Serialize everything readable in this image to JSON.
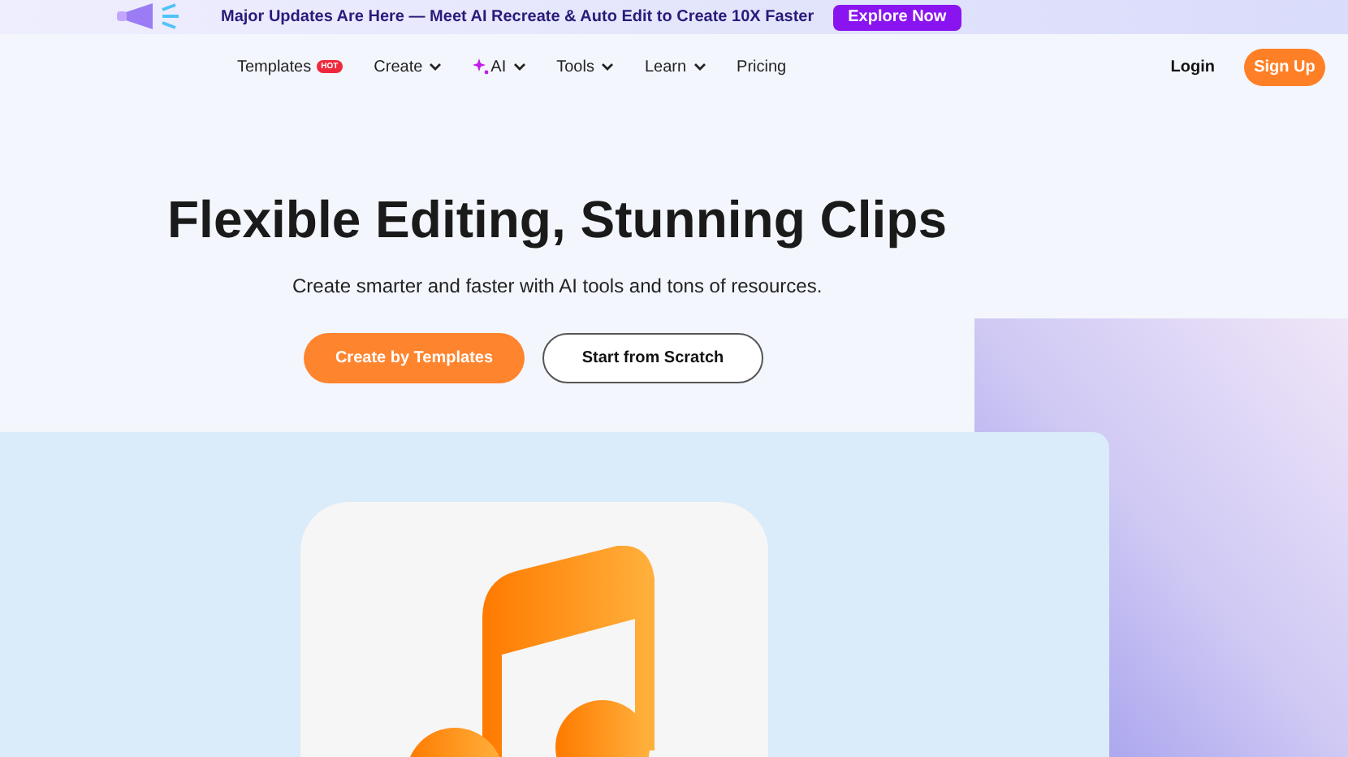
{
  "banner": {
    "text": "Major Updates Are Here — Meet AI Recreate & Auto Edit to Create 10X Faster",
    "button": "Explore Now"
  },
  "nav": {
    "items": [
      {
        "label": "Templates",
        "badge": "HOT",
        "dropdown": false,
        "kind": "plain"
      },
      {
        "label": "Create",
        "dropdown": true,
        "kind": "plain"
      },
      {
        "label": "AI",
        "dropdown": true,
        "kind": "ai"
      },
      {
        "label": "Tools",
        "dropdown": true,
        "kind": "plain"
      },
      {
        "label": "Learn",
        "dropdown": true,
        "kind": "plain"
      },
      {
        "label": "Pricing",
        "dropdown": false,
        "kind": "plain"
      }
    ],
    "login": "Login",
    "signup": "Sign Up"
  },
  "hero": {
    "title": "Flexible Editing, Stunning Clips",
    "subtitle": "Create smarter and faster with AI tools and tons of resources.",
    "primary_button": "Create by Templates",
    "secondary_button": "Start from Scratch"
  }
}
